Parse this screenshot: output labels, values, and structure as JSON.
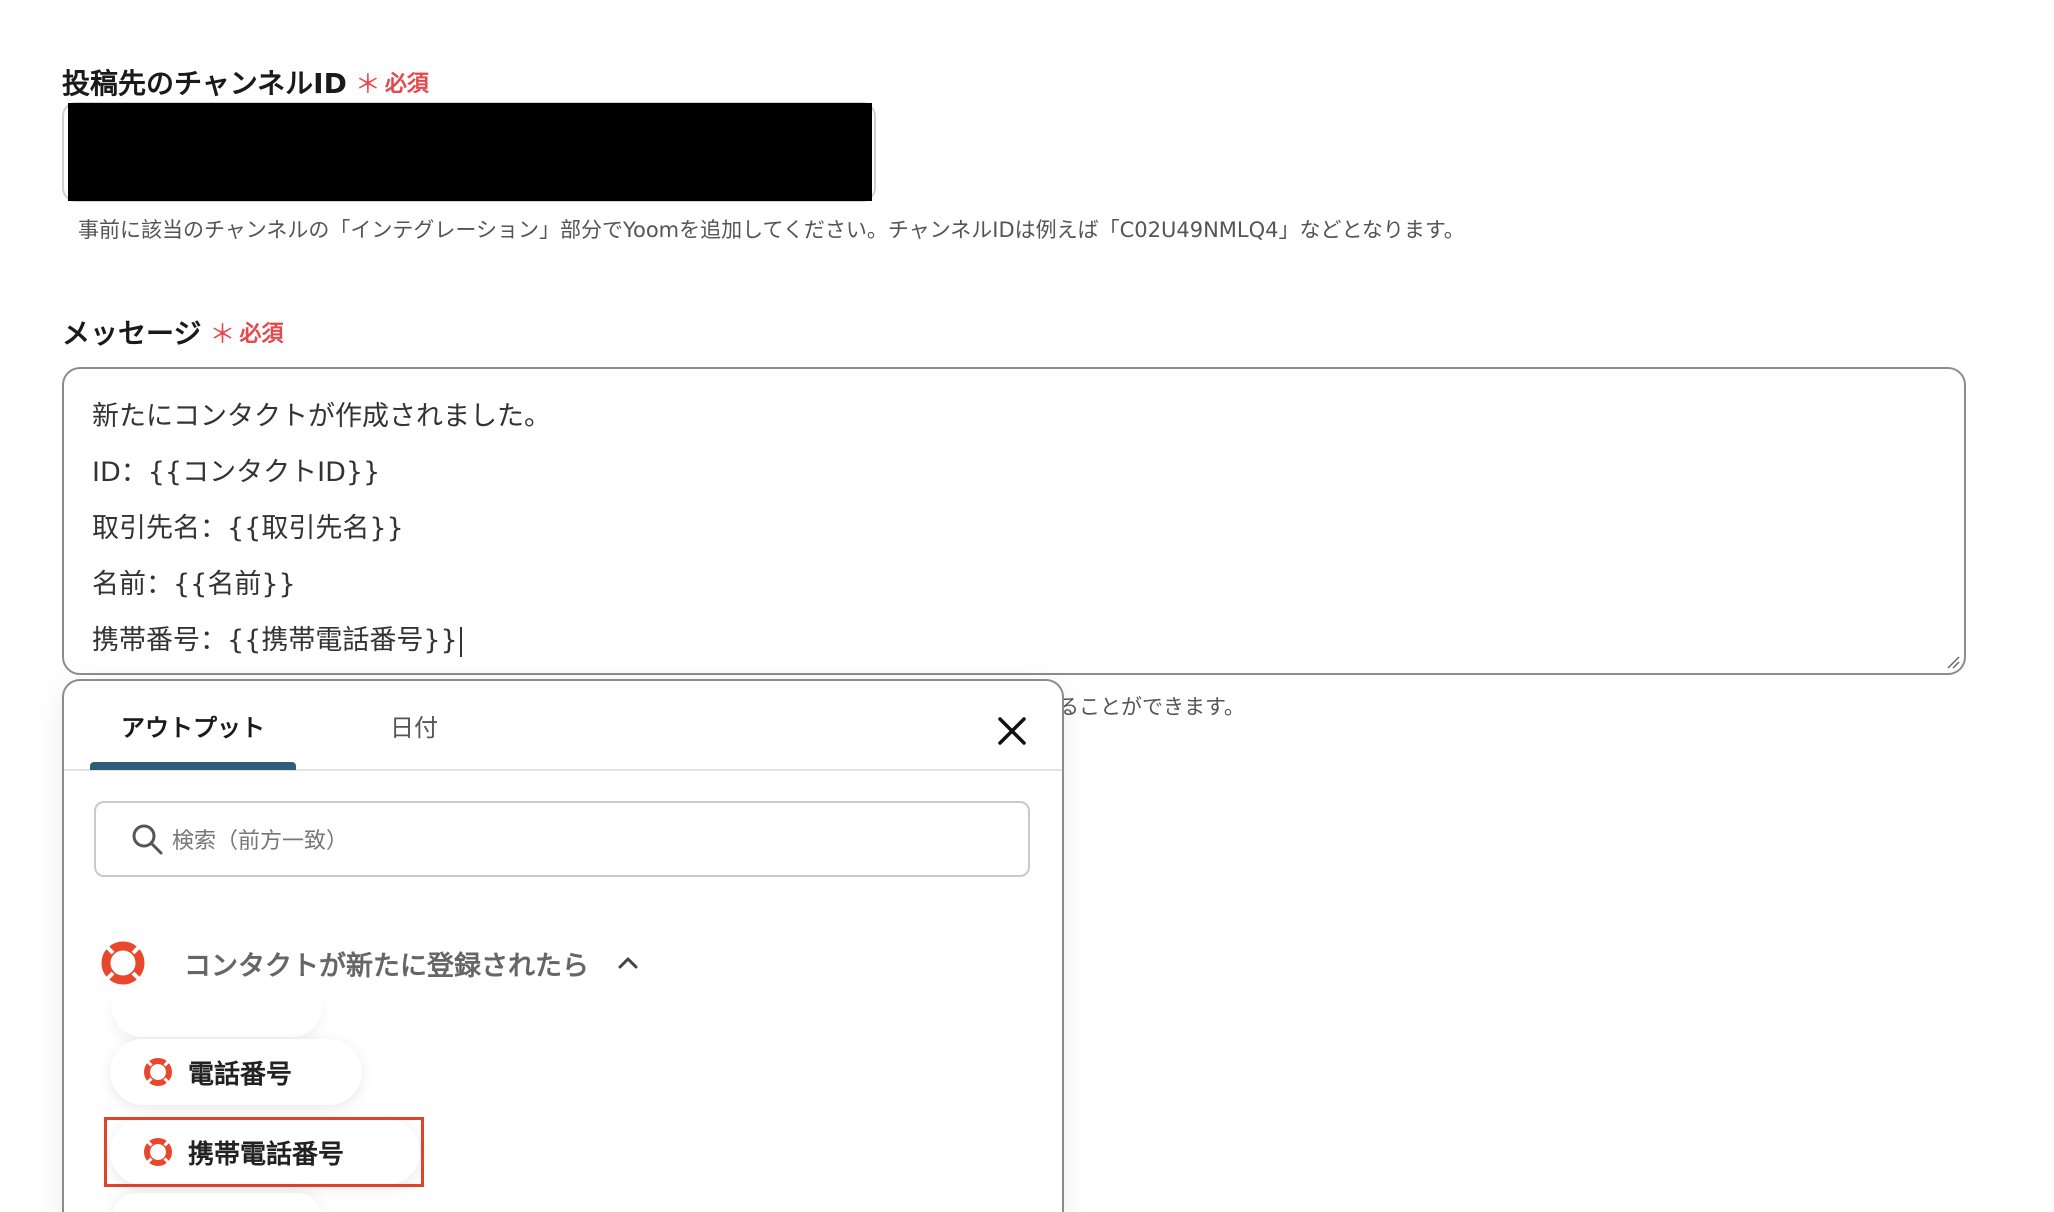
{
  "channel_field": {
    "label": "投稿先のチャンネルID",
    "required_mark": "＊",
    "required_text": "必須",
    "help": "事前に該当のチャンネルの「インテグレーション」部分でYoomを追加してください。チャンネルIDは例えば「C02U49NMLQ4」などとなります。"
  },
  "message_field": {
    "label": "メッセージ",
    "required_mark": "＊",
    "required_text": "必須",
    "lines": [
      "新たにコンタクトが作成されました。",
      "ID：{{コンタクトID}}",
      "取引先名：{{取引先名}}",
      "名前：{{名前}}",
      "携帯番号：{{携帯電話番号}}"
    ],
    "help_partial": "ることができます。"
  },
  "dropdown": {
    "tabs": [
      {
        "label": "アウトプット",
        "active": true
      },
      {
        "label": "日付",
        "active": false
      }
    ],
    "search_placeholder": "検索（前方一致）",
    "group_title": "コンタクトが新たに登録されたら",
    "items": [
      {
        "label": "電話番号",
        "highlighted": false
      },
      {
        "label": "携帯電話番号",
        "highlighted": true
      }
    ],
    "icons": {
      "close": "close-icon",
      "search": "search-icon",
      "chevron": "chevron-up-icon",
      "app_logo": "lifebuoy-logo-icon"
    }
  },
  "colors": {
    "required": "#e5484d",
    "tab_underline": "#2f5c77",
    "highlight": "#e0432b",
    "app_logo": "#e8472c"
  }
}
